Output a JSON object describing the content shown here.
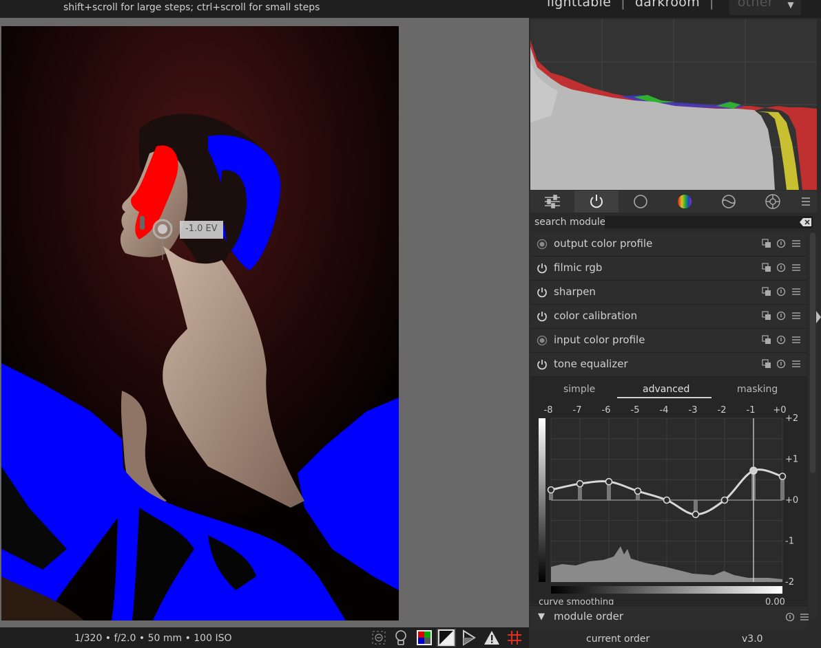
{
  "topbar": {
    "hint": "shift+scroll for large steps; ctrl+scroll for small steps",
    "views": {
      "lighttable": "lighttable",
      "darkroom": "darkroom",
      "other": "other"
    }
  },
  "canvas": {
    "ev_tooltip": "-1.0 EV"
  },
  "footer": {
    "exif": "1/320 • f/2.0 • 50 mm • 100 ISO",
    "buttons": [
      "zoom-icon",
      "bulb-icon",
      "color-assessment-icon",
      "focus-peaking-icon",
      "gamut-check-icon",
      "overexposed-warning-icon",
      "guides-icon"
    ]
  },
  "module_tabs": [
    "quick-access-icon",
    "active-modules-icon",
    "base-modules-icon",
    "color-modules-icon",
    "correction-modules-icon",
    "effects-modules-icon",
    "presets-menu-icon"
  ],
  "search": {
    "label": "search module",
    "value": ""
  },
  "modules": [
    {
      "name": "output color profile",
      "enabled_style": "dot"
    },
    {
      "name": "filmic rgb",
      "enabled_style": "power"
    },
    {
      "name": "sharpen",
      "enabled_style": "power"
    },
    {
      "name": "color calibration",
      "enabled_style": "power"
    },
    {
      "name": "input color profile",
      "enabled_style": "dot"
    },
    {
      "name": "tone equalizer",
      "enabled_style": "power"
    }
  ],
  "tone_equalizer": {
    "tabs": [
      "simple",
      "advanced",
      "masking"
    ],
    "active_tab": "advanced",
    "x_labels": [
      "-8",
      "-7",
      "-6",
      "-5",
      "-4",
      "-3",
      "-2",
      "-1",
      "+0"
    ],
    "y_labels": [
      "+2",
      "+1",
      "+0",
      "-1",
      "-2"
    ],
    "curve_points_ev": [
      0.25,
      0.4,
      0.45,
      0.22,
      0.0,
      -0.35,
      0.0,
      0.72,
      0.58
    ],
    "selected_band": "-1",
    "curve_smoothing_label": "curve smoothing",
    "curve_smoothing_value": "0.00"
  },
  "module_order": {
    "title": "module order",
    "current_order_label": "current order",
    "version": "v3.0"
  },
  "colors": {
    "accent_blue": "#0000ff",
    "accent_red": "#ff0000",
    "panel": "#2a2a2a"
  }
}
